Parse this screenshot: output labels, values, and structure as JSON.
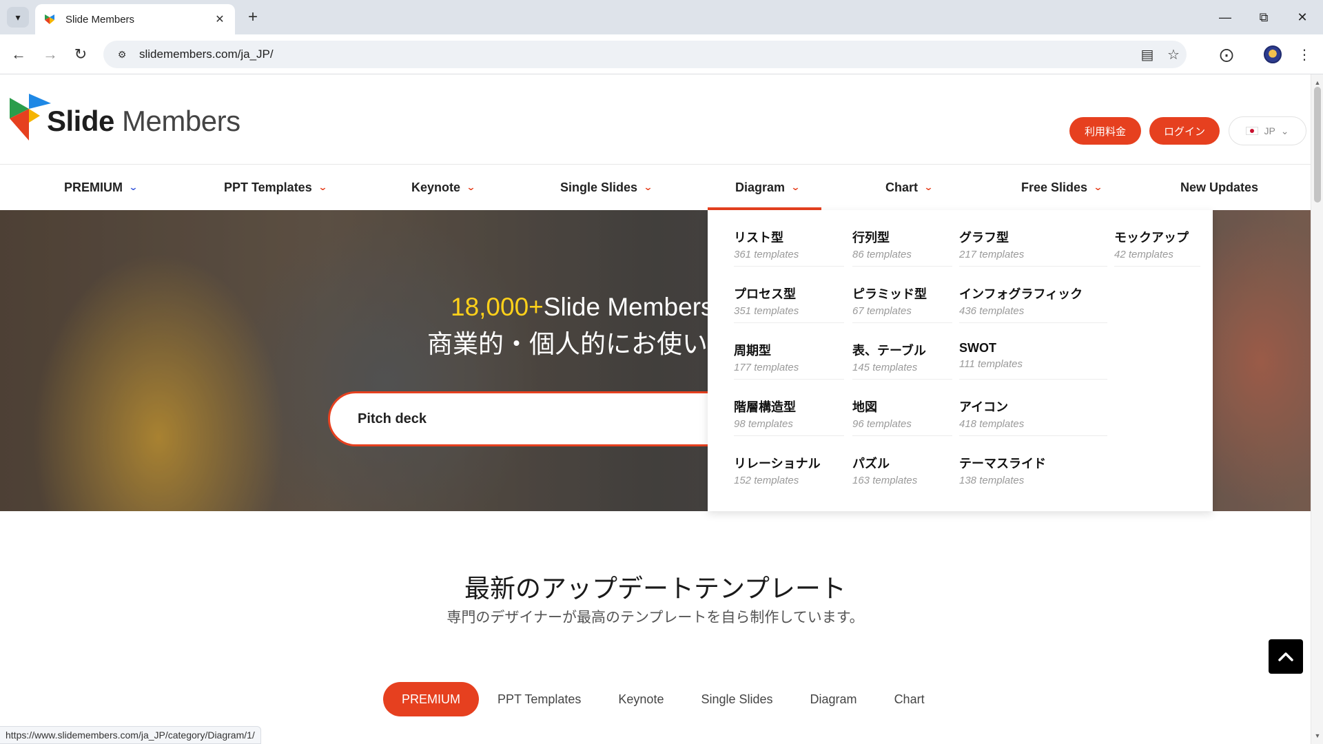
{
  "browser": {
    "tab_title": "Slide Members",
    "url": "slidemembers.com/ja_JP/",
    "status_url": "https://www.slidemembers.com/ja_JP/category/Diagram/1/"
  },
  "header": {
    "logo_bold": "Slide",
    "logo_light": " Members",
    "pricing_button": "利用料金",
    "login_button": "ログイン",
    "language": "JP"
  },
  "nav": [
    {
      "label": "PREMIUM"
    },
    {
      "label": "PPT Templates"
    },
    {
      "label": "Keynote"
    },
    {
      "label": "Single Slides"
    },
    {
      "label": "Diagram"
    },
    {
      "label": "Chart"
    },
    {
      "label": "Free Slides"
    },
    {
      "label": "New Updates"
    }
  ],
  "hero": {
    "count_accent": "18,000+",
    "line1_rest": "Slide Members",
    "line2": "商業的・個人的にお使い",
    "search_value": "Pitch deck"
  },
  "diagram_menu": [
    {
      "name": "リスト型",
      "count": "361 templates"
    },
    {
      "name": "行列型",
      "count": "86 templates"
    },
    {
      "name": "グラフ型",
      "count": "217 templates"
    },
    {
      "name": "モックアップ",
      "count": "42 templates"
    },
    {
      "name": "プロセス型",
      "count": "351 templates"
    },
    {
      "name": "ピラミッド型",
      "count": "67 templates"
    },
    {
      "name": "インフォグラフィック",
      "count": "436 templates"
    },
    {
      "name": "周期型",
      "count": "177 templates"
    },
    {
      "name": "表、テーブル",
      "count": "145 templates"
    },
    {
      "name": "SWOT",
      "count": "111 templates"
    },
    {
      "name": "階層構造型",
      "count": "98 templates"
    },
    {
      "name": "地図",
      "count": "96 templates"
    },
    {
      "name": "アイコン",
      "count": "418 templates"
    },
    {
      "name": "リレーショナル",
      "count": "152 templates"
    },
    {
      "name": "パズル",
      "count": "163 templates"
    },
    {
      "name": "テーマスライド",
      "count": "138 templates"
    }
  ],
  "section": {
    "title": "最新のアップデートテンプレート",
    "subtitle": "専門のデザイナーが最高のテンプレートを自ら制作しています。"
  },
  "category_tabs": [
    {
      "label": "PREMIUM",
      "active": true
    },
    {
      "label": "PPT Templates"
    },
    {
      "label": "Keynote"
    },
    {
      "label": "Single Slides"
    },
    {
      "label": "Diagram"
    },
    {
      "label": "Chart"
    }
  ],
  "colors": {
    "accent": "#e6401f",
    "hero_highlight": "#ffd11a"
  }
}
